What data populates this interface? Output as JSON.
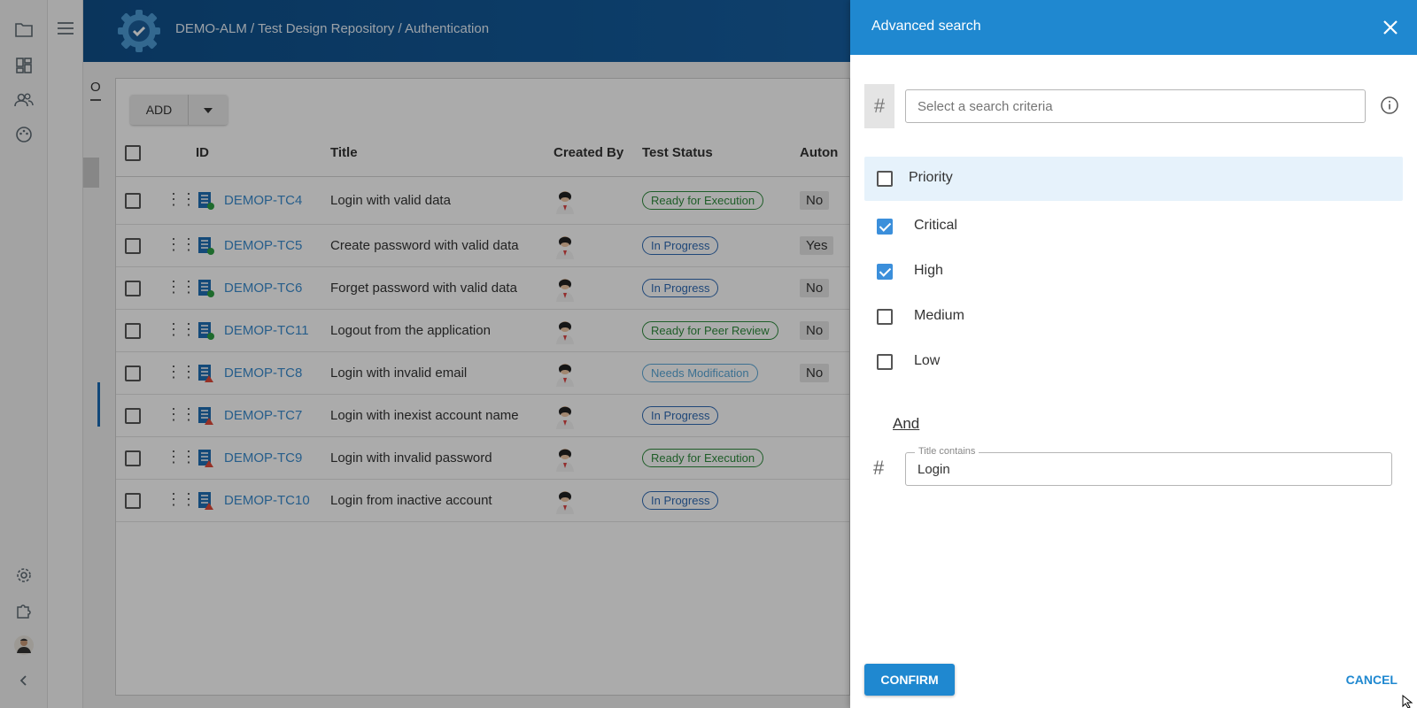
{
  "header": {
    "breadcrumb": "DEMO-ALM / Test Design Repository / Authentication"
  },
  "subtab_label": "O",
  "toolbar": {
    "add_label": "ADD"
  },
  "table": {
    "columns": [
      "ID",
      "Title",
      "Created By",
      "Test Status",
      "Auton"
    ],
    "rows": [
      {
        "id": "DEMOP-TC4",
        "title": "Login with valid data",
        "status": "Ready for Execution",
        "auto": "No"
      },
      {
        "id": "DEMOP-TC5",
        "title": "Create password with valid data",
        "status": "In Progress",
        "auto": "Yes"
      },
      {
        "id": "DEMOP-TC6",
        "title": "Forget password with valid data",
        "status": "In Progress",
        "auto": "No"
      },
      {
        "id": "DEMOP-TC11",
        "title": "Logout from the application",
        "status": "Ready for Peer Review",
        "auto": "No"
      },
      {
        "id": "DEMOP-TC8",
        "title": "Login with invalid email",
        "status": "Needs Modification",
        "auto": "No"
      },
      {
        "id": "DEMOP-TC7",
        "title": "Login with inexist account name",
        "status": "In Progress",
        "auto": ""
      },
      {
        "id": "DEMOP-TC9",
        "title": "Login with invalid password",
        "status": "Ready for Execution",
        "auto": ""
      },
      {
        "id": "DEMOP-TC10",
        "title": "Login from inactive account",
        "status": "In Progress",
        "auto": ""
      }
    ]
  },
  "drawer": {
    "title": "Advanced search",
    "hash": "#",
    "search_placeholder": "Select a search criteria",
    "priority_label": "Priority",
    "options": [
      {
        "label": "Critical",
        "checked": true
      },
      {
        "label": "High",
        "checked": true
      },
      {
        "label": "Medium",
        "checked": false
      },
      {
        "label": "Low",
        "checked": false
      }
    ],
    "and_label": "And",
    "title_field_legend": "Title contains",
    "title_field_value": "Login",
    "confirm_label": "CONFIRM",
    "cancel_label": "CANCEL"
  },
  "colors": {
    "header_blue": "#1a6bb3",
    "drawer_blue": "#1f88d0",
    "link_blue": "#3b8dcf",
    "status_green": "#2e8b3c"
  }
}
